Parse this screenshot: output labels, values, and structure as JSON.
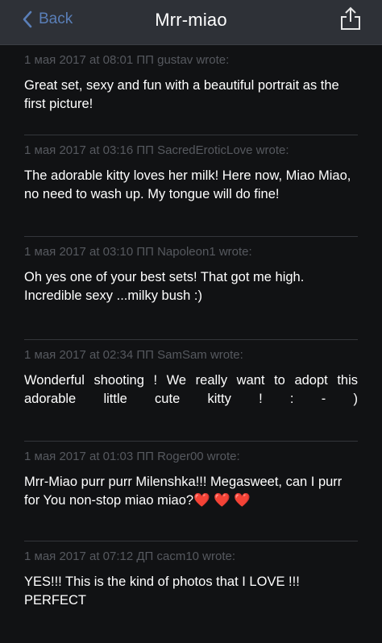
{
  "navbar": {
    "back_label": "Back",
    "title": "Mrr-miao",
    "accent_color": "#5a7fb8"
  },
  "comments": [
    {
      "meta": "1 мая 2017 at 08:01 ПП gustav wrote:",
      "text": "Great set, sexy and fun with a beautiful portrait as the first picture!"
    },
    {
      "meta": "1 мая 2017 at 03:16 ПП SacredEroticLove wrote:",
      "text": "The adorable kitty loves her milk! Here now, Miao Miao, no need to wash up. My tongue will do fine!"
    },
    {
      "meta": "1 мая 2017 at 03:10 ПП Napoleon1 wrote:",
      "text": "Oh yes one of your best sets! That got me high. Incredible sexy ...milky bush :)"
    },
    {
      "meta": "1 мая 2017 at 02:34 ПП SamSam wrote:",
      "text": "Wonderful shooting ! We really want to adopt this adorable little cute kitty ! : - )"
    },
    {
      "meta": "1 мая 2017 at 01:03 ПП Roger00 wrote:",
      "text": "Mrr-Miao purr purr Milenshka!!! Megasweet, can I purr for You non-stop miao miao?",
      "hearts": "❤️ ❤️ ❤️"
    },
    {
      "meta": "1 мая 2017 at 07:12 ДП сасm10 wrote:",
      "text": "YES!!! This is the kind of photos that I  LOVE !!! PERFECT"
    }
  ]
}
